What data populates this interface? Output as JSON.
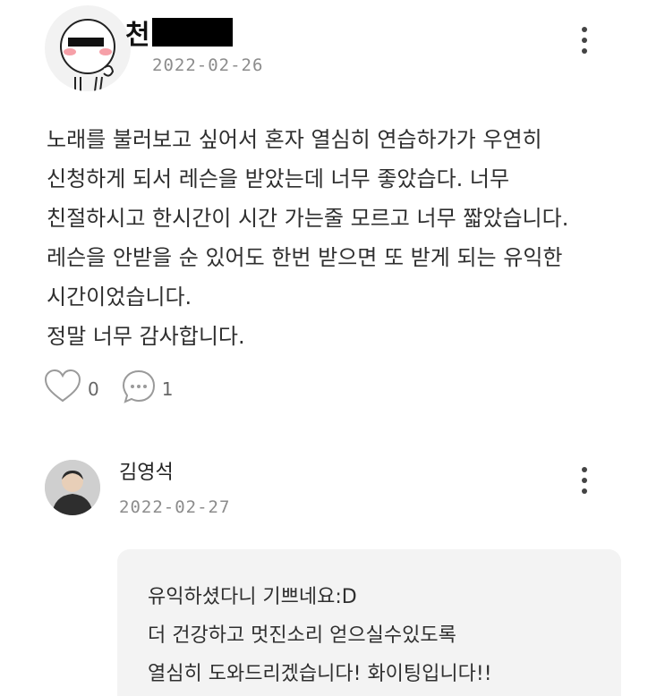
{
  "post": {
    "author_visible": "천",
    "date": "2022-02-26",
    "body": [
      "노래를 불러보고 싶어서 혼자 열심히 연습하가가 우연히",
      "신청하게 되서 레슨을 받았는데 너무 좋았습다. 너무",
      "친절하시고 한시간이 시간 가는줄 모르고 너무 짧았습니다.",
      "레슨을 안받을 순 있어도 한번 받으면 또 받게 되는 유익한",
      "시간이었습니다.",
      "정말 너무 감사합니다."
    ],
    "likes": "0",
    "comments": "1"
  },
  "comment": {
    "author": "김영석",
    "date": "2022-02-27",
    "body": [
      "유익하셨다니 기쁘네요:D",
      "더 건강하고 멋진소리 얻으실수있도록",
      "열심히 도와드리겠습니다! 화이팅입니다!!"
    ]
  },
  "icons": {
    "like": "heart-icon",
    "comment": "speech-bubble-icon",
    "menu": "more-vertical-icon"
  },
  "colors": {
    "text": "#2f2f2f",
    "date": "#8c8c8c",
    "reply_bg": "#f3f3f3"
  }
}
